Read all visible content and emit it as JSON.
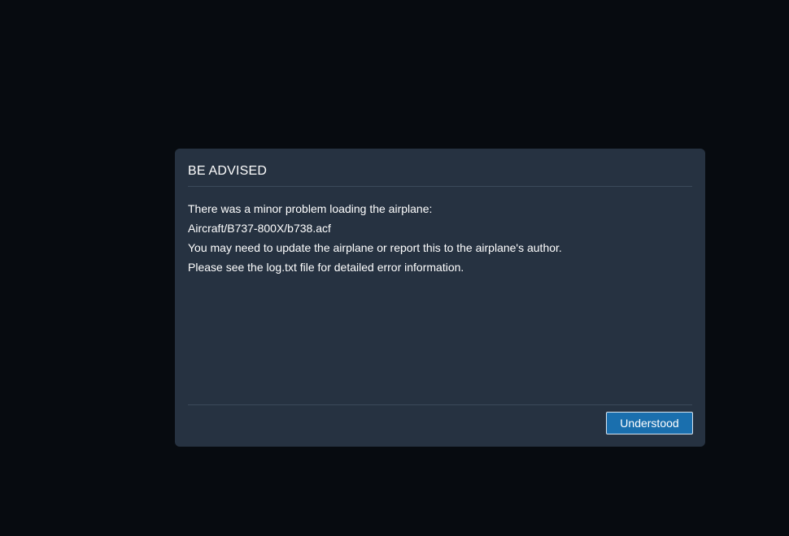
{
  "dialog": {
    "title": "BE ADVISED",
    "lines": [
      "There was a minor problem loading the airplane:",
      "Aircraft/B737-800X/b738.acf",
      "You may need to update the airplane or report this to the airplane's author.",
      "Please see the log.txt file for detailed error information."
    ],
    "button_label": "Understood"
  },
  "colors": {
    "background": "#070b10",
    "dialog_background": "#263241",
    "button": "#1a6fae",
    "text": "#ffffff"
  }
}
